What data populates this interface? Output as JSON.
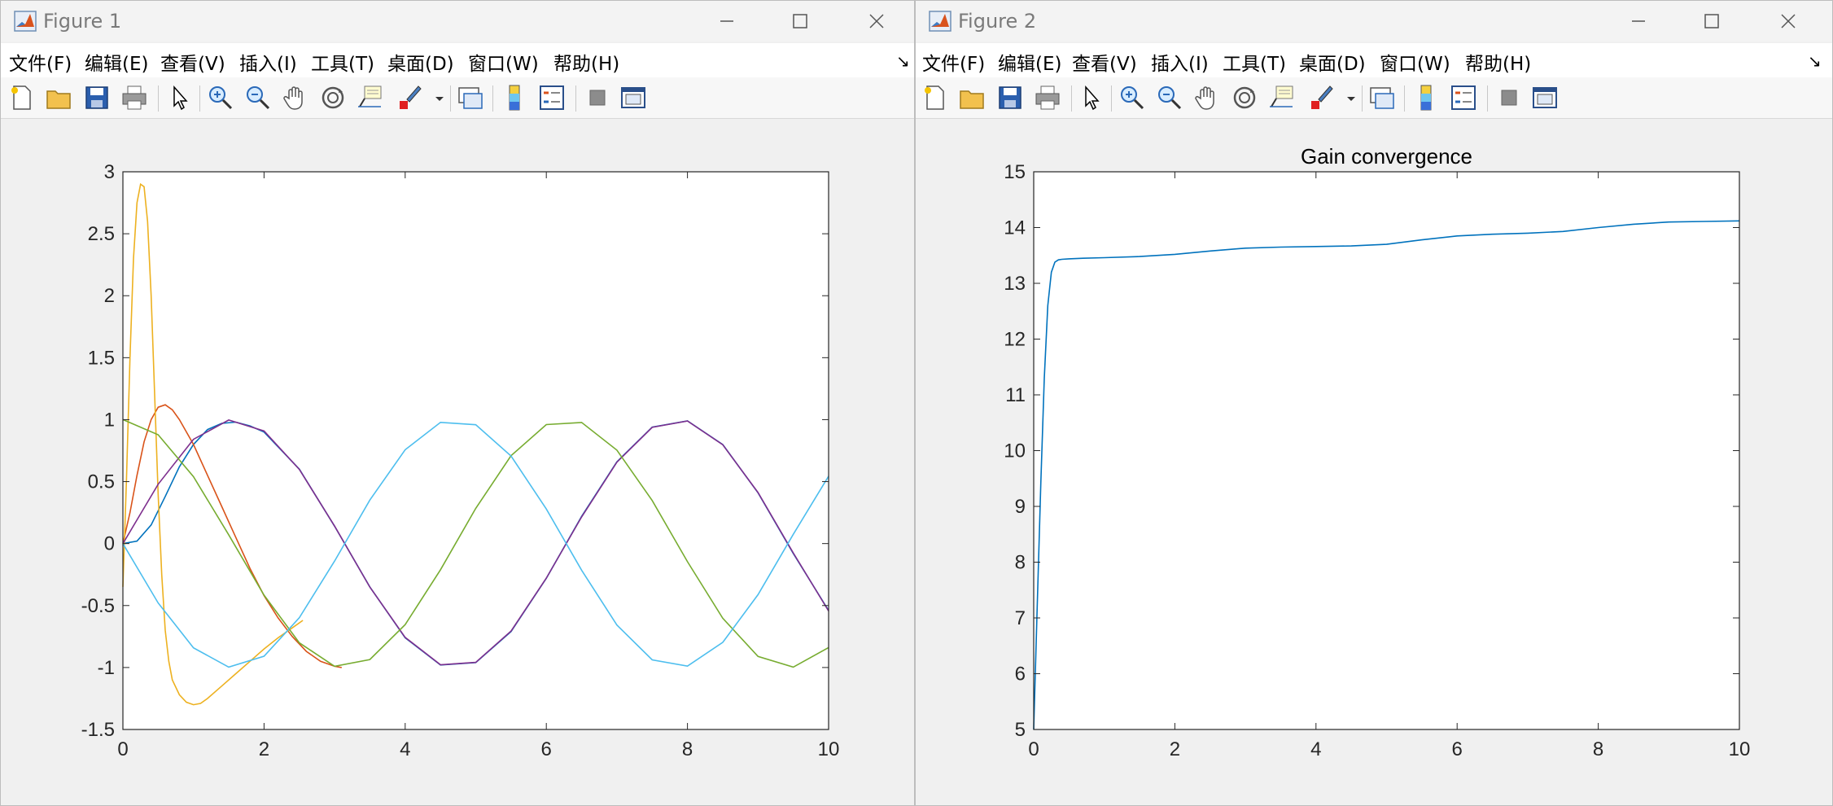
{
  "windows": [
    {
      "title": "Figure 1",
      "menu": [
        "文件(F)",
        "编辑(E)",
        "查看(V)",
        "插入(I)",
        "工具(T)",
        "桌面(D)",
        "窗口(W)",
        "帮助(H)"
      ],
      "chart_data": {
        "type": "line",
        "title": "",
        "xlabel": "",
        "ylabel": "",
        "xlim": [
          0,
          10
        ],
        "ylim": [
          -1.5,
          3
        ],
        "xticks": [
          "0",
          "2",
          "4",
          "6",
          "8",
          "10"
        ],
        "yticks": [
          "-1.5",
          "-1",
          "-0.5",
          "0",
          "0.5",
          "1",
          "1.5",
          "2",
          "2.5",
          "3"
        ],
        "grid": false,
        "series": [
          {
            "color": "#0072BD",
            "x": [
              0,
              0.2,
              0.4,
              0.6,
              0.8,
              1.0,
              1.2,
              1.4,
              1.6,
              1.8,
              2.0,
              2.5,
              3,
              3.5,
              4,
              4.5,
              5,
              5.5,
              6,
              6.5,
              7,
              7.5,
              8,
              8.5,
              9,
              9.5,
              10
            ],
            "y": [
              0,
              0.02,
              0.15,
              0.38,
              0.62,
              0.8,
              0.92,
              0.97,
              0.98,
              0.95,
              0.9,
              0.6,
              0.14,
              -0.35,
              -0.76,
              -0.98,
              -0.96,
              -0.71,
              -0.28,
              0.22,
              0.66,
              0.94,
              0.99,
              0.8,
              0.41,
              -0.08,
              -0.54
            ]
          },
          {
            "color": "#D95319",
            "x": [
              0,
              0.1,
              0.2,
              0.3,
              0.4,
              0.5,
              0.6,
              0.7,
              0.8,
              1.0,
              1.2,
              1.4,
              1.6,
              1.8,
              2.0,
              2.2,
              2.4,
              2.6,
              2.8,
              3.0,
              3.1
            ],
            "y": [
              0,
              0.25,
              0.55,
              0.82,
              1.0,
              1.1,
              1.12,
              1.08,
              1.0,
              0.8,
              0.55,
              0.3,
              0.05,
              -0.2,
              -0.42,
              -0.6,
              -0.75,
              -0.87,
              -0.95,
              -0.99,
              -1.0
            ]
          },
          {
            "color": "#EDB120",
            "x": [
              0,
              0.05,
              0.1,
              0.15,
              0.2,
              0.25,
              0.3,
              0.35,
              0.4,
              0.45,
              0.5,
              0.55,
              0.6,
              0.65,
              0.7,
              0.8,
              0.9,
              1.0,
              1.1,
              1.2,
              1.4,
              1.6,
              1.8,
              2.0,
              2.2,
              2.4,
              2.55
            ],
            "y": [
              -0.35,
              0.5,
              1.5,
              2.3,
              2.75,
              2.9,
              2.88,
              2.6,
              2.0,
              1.2,
              0.4,
              -0.25,
              -0.7,
              -0.95,
              -1.1,
              -1.22,
              -1.28,
              -1.3,
              -1.29,
              -1.25,
              -1.15,
              -1.05,
              -0.95,
              -0.85,
              -0.76,
              -0.68,
              -0.62
            ]
          },
          {
            "color": "#7E2F8E",
            "x": [
              0,
              0.5,
              1.0,
              1.5,
              2.0,
              2.5,
              3.0,
              3.5,
              4.0,
              4.5,
              5.0,
              5.5,
              6.0,
              6.5,
              7.0,
              7.5,
              8.0,
              8.5,
              9.0,
              9.5,
              10.0
            ],
            "y": [
              0,
              0.479,
              0.841,
              0.997,
              0.909,
              0.598,
              0.141,
              -0.351,
              -0.757,
              -0.978,
              -0.959,
              -0.706,
              -0.279,
              0.215,
              0.657,
              0.938,
              0.989,
              0.798,
              0.412,
              -0.075,
              -0.544
            ]
          },
          {
            "color": "#77AC30",
            "x": [
              0,
              0.5,
              1.0,
              1.5,
              2.0,
              2.5,
              3.0,
              3.5,
              4.0,
              4.5,
              5.0,
              5.5,
              6.0,
              6.5,
              7.0,
              7.5,
              8.0,
              8.5,
              9.0,
              9.5,
              10.0
            ],
            "y": [
              1,
              0.878,
              0.54,
              0.071,
              -0.416,
              -0.801,
              -0.99,
              -0.936,
              -0.654,
              -0.211,
              0.284,
              0.709,
              0.96,
              0.977,
              0.754,
              0.347,
              -0.146,
              -0.602,
              -0.911,
              -0.997,
              -0.839
            ]
          },
          {
            "color": "#4DBEEE",
            "x": [
              0,
              0.5,
              1.0,
              1.5,
              2.0,
              2.5,
              3.0,
              3.5,
              4.0,
              4.5,
              5.0,
              5.5,
              6.0,
              6.5,
              7.0,
              7.5,
              8.0,
              8.5,
              9.0,
              9.5,
              10.0
            ],
            "y": [
              0,
              -0.479,
              -0.841,
              -0.997,
              -0.909,
              -0.598,
              -0.141,
              0.351,
              0.757,
              0.978,
              0.959,
              0.706,
              0.279,
              -0.215,
              -0.657,
              -0.938,
              -0.989,
              -0.798,
              -0.412,
              0.075,
              0.544
            ]
          }
        ]
      }
    },
    {
      "title": "Figure 2",
      "menu": [
        "文件(F)",
        "编辑(E)",
        "查看(V)",
        "插入(I)",
        "工具(T)",
        "桌面(D)",
        "窗口(W)",
        "帮助(H)"
      ],
      "chart_data": {
        "type": "line",
        "title": "Gain convergence",
        "xlabel": "",
        "ylabel": "",
        "xlim": [
          0,
          10
        ],
        "ylim": [
          5,
          15
        ],
        "xticks": [
          "0",
          "2",
          "4",
          "6",
          "8",
          "10"
        ],
        "yticks": [
          "5",
          "6",
          "7",
          "8",
          "9",
          "10",
          "11",
          "12",
          "13",
          "14",
          "15"
        ],
        "grid": false,
        "series": [
          {
            "color": "#0072BD",
            "x": [
              0,
              0.05,
              0.1,
              0.15,
              0.2,
              0.25,
              0.3,
              0.35,
              0.4,
              0.5,
              0.7,
              1.0,
              1.5,
              2.0,
              2.5,
              3.0,
              3.5,
              4.0,
              4.5,
              5.0,
              5.5,
              6.0,
              6.5,
              7.0,
              7.5,
              8.0,
              8.5,
              9.0,
              9.5,
              10.0
            ],
            "y": [
              5,
              7.2,
              9.4,
              11.3,
              12.6,
              13.2,
              13.38,
              13.42,
              13.43,
              13.44,
              13.45,
              13.46,
              13.48,
              13.52,
              13.58,
              13.63,
              13.65,
              13.66,
              13.67,
              13.7,
              13.78,
              13.85,
              13.88,
              13.9,
              13.93,
              14.0,
              14.06,
              14.1,
              14.11,
              14.12
            ]
          }
        ]
      }
    }
  ]
}
